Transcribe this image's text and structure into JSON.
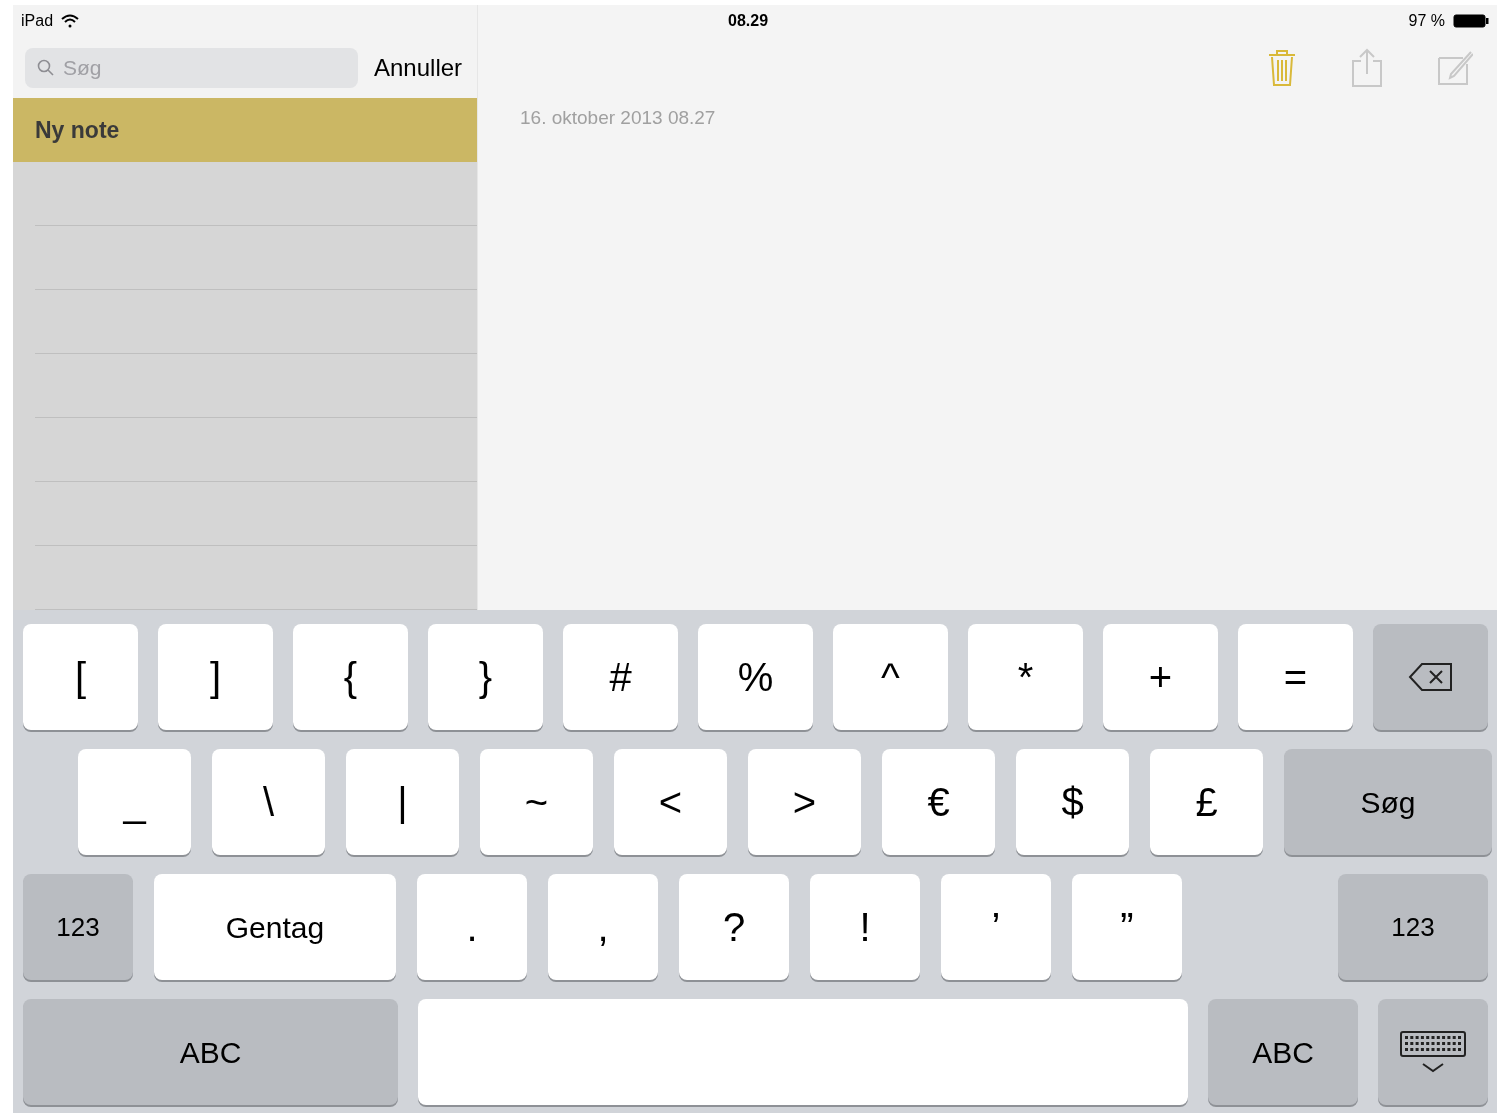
{
  "status_bar": {
    "device": "iPad",
    "time": "08.29",
    "battery": "97 %"
  },
  "search": {
    "placeholder": "Søg",
    "cancel": "Annuller"
  },
  "notes": [
    {
      "title": "Ny note",
      "selected": true
    }
  ],
  "note": {
    "date": "16. oktober 2013 08.27"
  },
  "keyboard": {
    "rows": [
      {
        "keys": [
          {
            "kind": "char",
            "label": "["
          },
          {
            "kind": "char",
            "label": "]"
          },
          {
            "kind": "char",
            "label": "{"
          },
          {
            "kind": "char",
            "label": "}"
          },
          {
            "kind": "char",
            "label": "#"
          },
          {
            "kind": "char",
            "label": "%"
          },
          {
            "kind": "char",
            "label": "^"
          },
          {
            "kind": "char",
            "label": "*"
          },
          {
            "kind": "char",
            "label": "+"
          },
          {
            "kind": "char",
            "label": "="
          },
          {
            "kind": "backspace"
          }
        ]
      },
      {
        "keys": [
          {
            "kind": "char",
            "label": "_"
          },
          {
            "kind": "char",
            "label": "\\"
          },
          {
            "kind": "char",
            "label": "|"
          },
          {
            "kind": "char",
            "label": "~"
          },
          {
            "kind": "char",
            "label": "<"
          },
          {
            "kind": "char",
            "label": ">"
          },
          {
            "kind": "char",
            "label": "€"
          },
          {
            "kind": "char",
            "label": "$"
          },
          {
            "kind": "char",
            "label": "£"
          },
          {
            "kind": "search",
            "label": "Søg"
          }
        ]
      },
      {
        "keys": [
          {
            "kind": "mode",
            "label": "123"
          },
          {
            "kind": "wide",
            "label": "Gentag"
          },
          {
            "kind": "char",
            "label": "."
          },
          {
            "kind": "char",
            "label": ","
          },
          {
            "kind": "char",
            "label": "?"
          },
          {
            "kind": "char",
            "label": "!"
          },
          {
            "kind": "char",
            "label": "’"
          },
          {
            "kind": "char",
            "label": "”"
          },
          {
            "kind": "mode",
            "label": "123"
          }
        ]
      },
      {
        "keys": [
          {
            "kind": "mode",
            "label": "ABC"
          },
          {
            "kind": "space"
          },
          {
            "kind": "mode",
            "label": "ABC"
          },
          {
            "kind": "hide"
          }
        ]
      }
    ]
  }
}
